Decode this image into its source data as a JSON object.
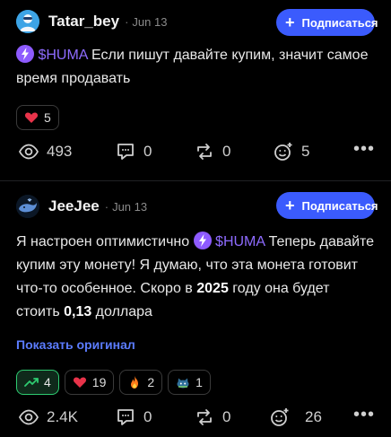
{
  "posts": [
    {
      "username": "Tatar_bey",
      "separator": "·",
      "date": "Jun 13",
      "follow_label": "Подписаться",
      "text_parts": [
        "$HUMA",
        " Если пишут давайте купим, значит самое время продавать"
      ],
      "reactions": [
        {
          "icon": "heart-icon",
          "count": "5"
        }
      ],
      "stats": {
        "views": "493",
        "comments": "0",
        "reposts": "0",
        "reactions": "5"
      }
    },
    {
      "username": "JeeJee",
      "separator": "·",
      "date": "Jun 13",
      "follow_label": "Подписаться",
      "text_parts": {
        "p1": "Я настроен оптимистично ",
        "ticker": "$HUMA",
        "p2": " Теперь давайте купим эту монету! Я думаю, что эта монета готовит что-то особенное. Скоро в ",
        "year": "2025",
        "p3": " году она будет стоить ",
        "price": "0,13",
        "p4": " доллара"
      },
      "show_original": "Показать оригинал",
      "reactions": [
        {
          "icon": "trend-up-icon",
          "count": "4",
          "active": true
        },
        {
          "icon": "heart-icon",
          "count": "19"
        },
        {
          "icon": "fire-icon",
          "count": "2"
        },
        {
          "icon": "cat-icon",
          "count": "1"
        }
      ],
      "stats": {
        "views": "2.4K",
        "comments": "0",
        "reposts": "0",
        "reactions": "26"
      }
    }
  ],
  "colors": {
    "accent": "#3b5bfd",
    "ticker": "#8e6bff",
    "link": "#5b7cff",
    "positive": "#2ecc71",
    "heart": "#e8334a"
  },
  "more_glyph": "•••"
}
